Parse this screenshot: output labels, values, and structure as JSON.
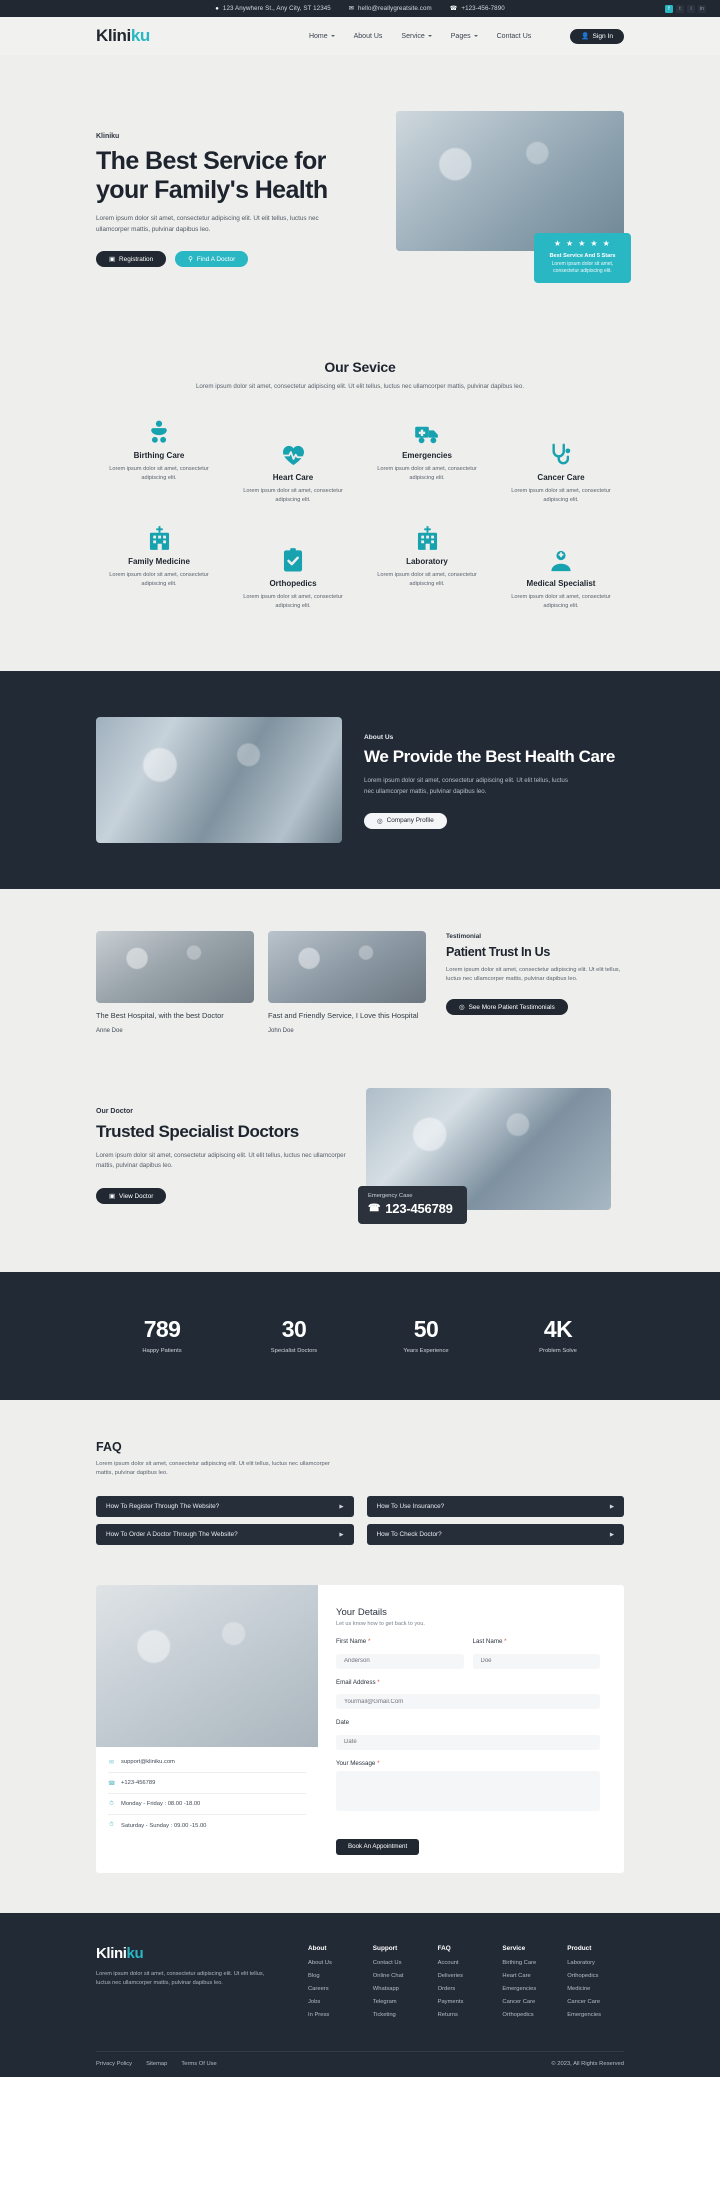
{
  "topbar": {
    "address": "123 Anywhere St., Any City, ST 12345",
    "email": "hello@reallygreatsite.com",
    "phone": "+123-456-7890",
    "socials": [
      "facebook-icon",
      "twitter-icon",
      "instagram-icon",
      "linkedin-icon"
    ]
  },
  "nav": {
    "logo_main": "Klini",
    "logo_accent": "ku",
    "links": [
      {
        "label": "Home",
        "has_dropdown": true
      },
      {
        "label": "About Us",
        "has_dropdown": false
      },
      {
        "label": "Service",
        "has_dropdown": true
      },
      {
        "label": "Pages",
        "has_dropdown": true
      },
      {
        "label": "Contact Us",
        "has_dropdown": false
      }
    ],
    "signin_label": "Sign In"
  },
  "hero": {
    "eyebrow": "Kliniku",
    "title": "The Best Service for your Family's Health",
    "paragraph": "Lorem ipsum dolor sit amet, consectetur adipiscing elit. Ut elit tellus, luctus nec ullamcorper mattis, pulvinar dapibus leo.",
    "btn_primary": "Registration",
    "btn_secondary": "Find A Doctor",
    "card": {
      "stars": "★ ★ ★ ★ ★",
      "title": "Best Service And 5 Stars",
      "text": "Lorem ipsum dolor sit amet, consectetur adipiscing elit."
    }
  },
  "services": {
    "title": "Our Sevice",
    "subtitle": "Lorem ipsum dolor sit amet, consectetur adipiscing elit. Ut elit tellus, luctus nec ullamcorper mattis, pulvinar dapibus leo.",
    "accent_color": "#17a2b0",
    "items": [
      {
        "name": "Birthing Care",
        "desc": "Lorem ipsum dolor sit amet, consectetur adipiscing elit.",
        "icon": "baby-icon"
      },
      {
        "name": "Heart Care",
        "desc": "Lorem ipsum dolor sit amet, consectetur adipiscing elit.",
        "icon": "heartbeat-icon"
      },
      {
        "name": "Emergencies",
        "desc": "Lorem ipsum dolor sit amet, consectetur adipiscing elit.",
        "icon": "ambulance-icon"
      },
      {
        "name": "Cancer Care",
        "desc": "Lorem ipsum dolor sit amet, consectetur adipiscing elit.",
        "icon": "stethoscope-icon"
      },
      {
        "name": "Family Medicine",
        "desc": "Lorem ipsum dolor sit amet, consectetur adipiscing elit.",
        "icon": "hospital-icon"
      },
      {
        "name": "Orthopedics",
        "desc": "Lorem ipsum dolor sit amet, consectetur adipiscing elit.",
        "icon": "clipboard-check-icon"
      },
      {
        "name": "Laboratory",
        "desc": "Lorem ipsum dolor sit amet, consectetur adipiscing elit.",
        "icon": "hospital-icon"
      },
      {
        "name": "Medical Specialist",
        "desc": "Lorem ipsum dolor sit amet, consectetur adipiscing elit.",
        "icon": "doctor-icon"
      }
    ]
  },
  "about": {
    "eyebrow": "About Us",
    "title": "We Provide the Best Health Care",
    "paragraph": "Lorem ipsum dolor sit amet, consectetur adipiscing elit. Ut elit tellus, luctus nec ullamcorper mattis, pulvinar dapibus leo.",
    "button": "Company Profile"
  },
  "testimonial": {
    "eyebrow": "Testimonial",
    "title": "Patient Trust In Us",
    "paragraph": "Lorem ipsum dolor sit amet, consectetur adipiscing elit. Ut elit tellus, luctus nec ullamcorper mattis, pulvinar dapibus leo.",
    "button": "See More Patient Testimonials",
    "cards": [
      {
        "quote": "The Best Hospital, with the best Doctor",
        "name": "Anne Doe"
      },
      {
        "quote": "Fast and Friendly Service, I Love this Hospital",
        "name": "John Doe"
      }
    ]
  },
  "doctors": {
    "eyebrow": "Our Doctor",
    "title": "Trusted Specialist Doctors",
    "paragraph": "Lorem ipsum dolor sit amet, consectetur adipiscing elit. Ut elit tellus, luctus nec ullamcorper mattis, pulvinar dapibus leo.",
    "button": "View Doctor",
    "emergency_label": "Emergency Case",
    "emergency_number": "123-456789"
  },
  "stats": [
    {
      "value": "789",
      "label": "Happy Patients"
    },
    {
      "value": "30",
      "label": "Specialist Doctors"
    },
    {
      "value": "50",
      "label": "Years Experience"
    },
    {
      "value": "4K",
      "label": "Problem Solve"
    }
  ],
  "faq": {
    "title": "FAQ",
    "paragraph": "Lorem ipsum dolor sit amet, consectetur adipiscing elit. Ut elit tellus, luctus nec ullamcorper mattis, pulvinar dapibus leo.",
    "items": [
      "How To Register Through The Website?",
      "How To Use Insurance?",
      "How To Order A Doctor Through The Website?",
      "How To Check Doctor?"
    ]
  },
  "contact": {
    "info": [
      {
        "icon": "mail-icon",
        "text": "support@kliniku.com"
      },
      {
        "icon": "phone-icon",
        "text": "+123-456789"
      },
      {
        "icon": "clock-icon",
        "text": "Monday - Friday : 08.00 -18.00"
      },
      {
        "icon": "clock-icon",
        "text": "Saturday - Sunday : 09.00 -15.00"
      }
    ],
    "form": {
      "heading": "Your Details",
      "subheading": "Let us know how to get back to you.",
      "first_name_label": "First Name",
      "first_name_value": "Anderson",
      "last_name_label": "Last Name",
      "last_name_value": "Doe",
      "email_label": "Email Address",
      "email_value": "Yourmail@Gmail.Com",
      "date_label": "Date",
      "date_placeholder": "Date",
      "message_label": "Your Message",
      "message_value": "",
      "submit": "Book An Appointment",
      "required_mark": "*"
    }
  },
  "footer": {
    "logo_main": "Klini",
    "logo_accent": "ku",
    "description": "Lorem ipsum dolor sit amet, consectetur adipiscing elit. Ut elit tellus, luctus nec ullamcorper mattis, pulvinar dapibus leo.",
    "columns": [
      {
        "heading": "About",
        "links": [
          "About Us",
          "Blog",
          "Careers",
          "Jobs",
          "In Press"
        ]
      },
      {
        "heading": "Support",
        "links": [
          "Contact Us",
          "Online Chat",
          "Whatsapp",
          "Telegram",
          "Ticketing"
        ]
      },
      {
        "heading": "FAQ",
        "links": [
          "Account",
          "Deliveries",
          "Orders",
          "Payments",
          "Returns"
        ]
      },
      {
        "heading": "Service",
        "links": [
          "Birthing Care",
          "Heart Care",
          "Emergencies",
          "Cancer Care",
          "Orthopedics"
        ]
      },
      {
        "heading": "Product",
        "links": [
          "Laboratory",
          "Orthopedics",
          "Medicine",
          "Cancer Care",
          "Emergencies"
        ]
      }
    ],
    "bottom_links": [
      "Privacy Policy",
      "Sitemap",
      "Terms Of Use"
    ],
    "copyright": "© 2023, All Rights Reserved"
  }
}
